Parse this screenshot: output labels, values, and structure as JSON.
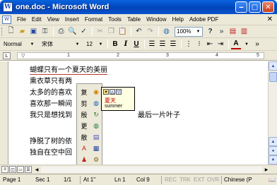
{
  "window": {
    "title": "one.doc - Microsoft Word",
    "app_icon": "W",
    "minimize": "‒",
    "maximize": "□",
    "close": "✕"
  },
  "menu": {
    "items": [
      "File",
      "Edit",
      "View",
      "Insert",
      "Format",
      "Tools",
      "Table",
      "Window",
      "Help",
      "Adobe PDF"
    ],
    "close": "✕"
  },
  "toolbar": {
    "zoom": "100%",
    "help": "?",
    "more": "»"
  },
  "formatting": {
    "style": "Normal",
    "font": "宋体",
    "size": "12",
    "bold": "B",
    "italic": "I",
    "underline": "U",
    "font_color": "A"
  },
  "ruler": {
    "numbers": [
      "1",
      "2",
      "3",
      "4",
      "5"
    ]
  },
  "document": {
    "lines": [
      "蝴蝶只有一个夏天的美丽",
      "熏衣草只有两",
      "太多的的喜欢",
      "喜欢那一瞬间",
      "我只是想找到",
      "最后一片叶子",
      "挣脱了树的依",
      "独自在空中回"
    ]
  },
  "ime": {
    "candidate_word": "夏天",
    "candidate_roman": "summer",
    "labels": [
      "复",
      "剪",
      "殷",
      "更",
      "散"
    ]
  },
  "status": {
    "page": "Page 1",
    "sec": "Sec 1",
    "pages": "1/1",
    "at": "At 1\"",
    "ln": "Ln 1",
    "col": "Col 9",
    "rec": "REC",
    "trk": "TRK",
    "ext": "EXT",
    "ovr": "OVR",
    "language": "Chinese (P"
  },
  "colors": {
    "title_bar": "#0a54d0",
    "chrome": "#ece9d8",
    "candidate_text": "#c00000"
  }
}
